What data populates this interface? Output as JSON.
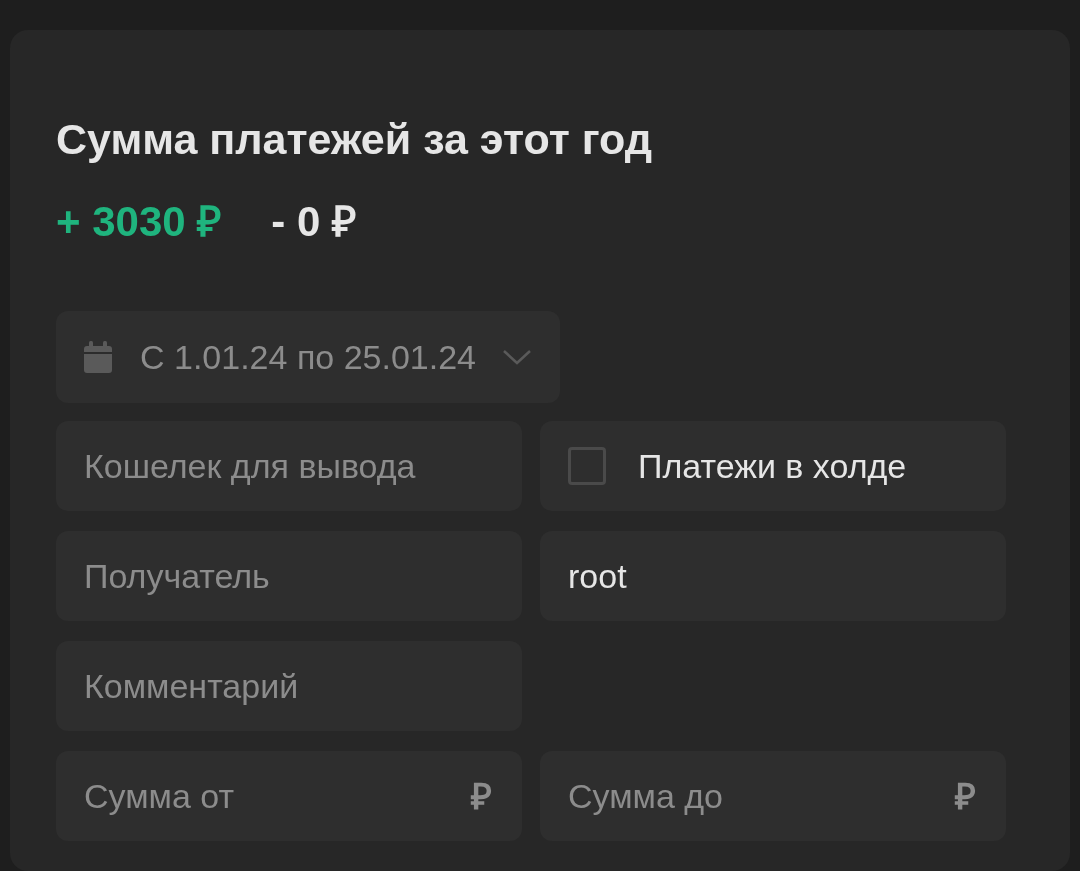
{
  "title": "Сумма платежей за этот год",
  "totals": [
    {
      "kind": "income",
      "text": "+ 3030 ₽"
    },
    {
      "kind": "expense",
      "text": "- 0 ₽"
    }
  ],
  "date_range": {
    "value": "С 1.01.24 по 25.01.24"
  },
  "filter_rows": [
    [
      {
        "kind": "field",
        "placeholder": "Кошелек для вывода"
      },
      {
        "kind": "checkbox",
        "label": "Платежи в холде",
        "checked": false
      }
    ],
    [
      {
        "kind": "field",
        "placeholder": "Получатель"
      },
      {
        "kind": "field",
        "value": "root"
      }
    ],
    [
      {
        "kind": "field",
        "placeholder": "Комментарий"
      }
    ],
    [
      {
        "kind": "amount",
        "placeholder": "Сумма от",
        "currency": "₽"
      },
      {
        "kind": "amount",
        "placeholder": "Сумма до",
        "currency": "₽"
      }
    ]
  ]
}
